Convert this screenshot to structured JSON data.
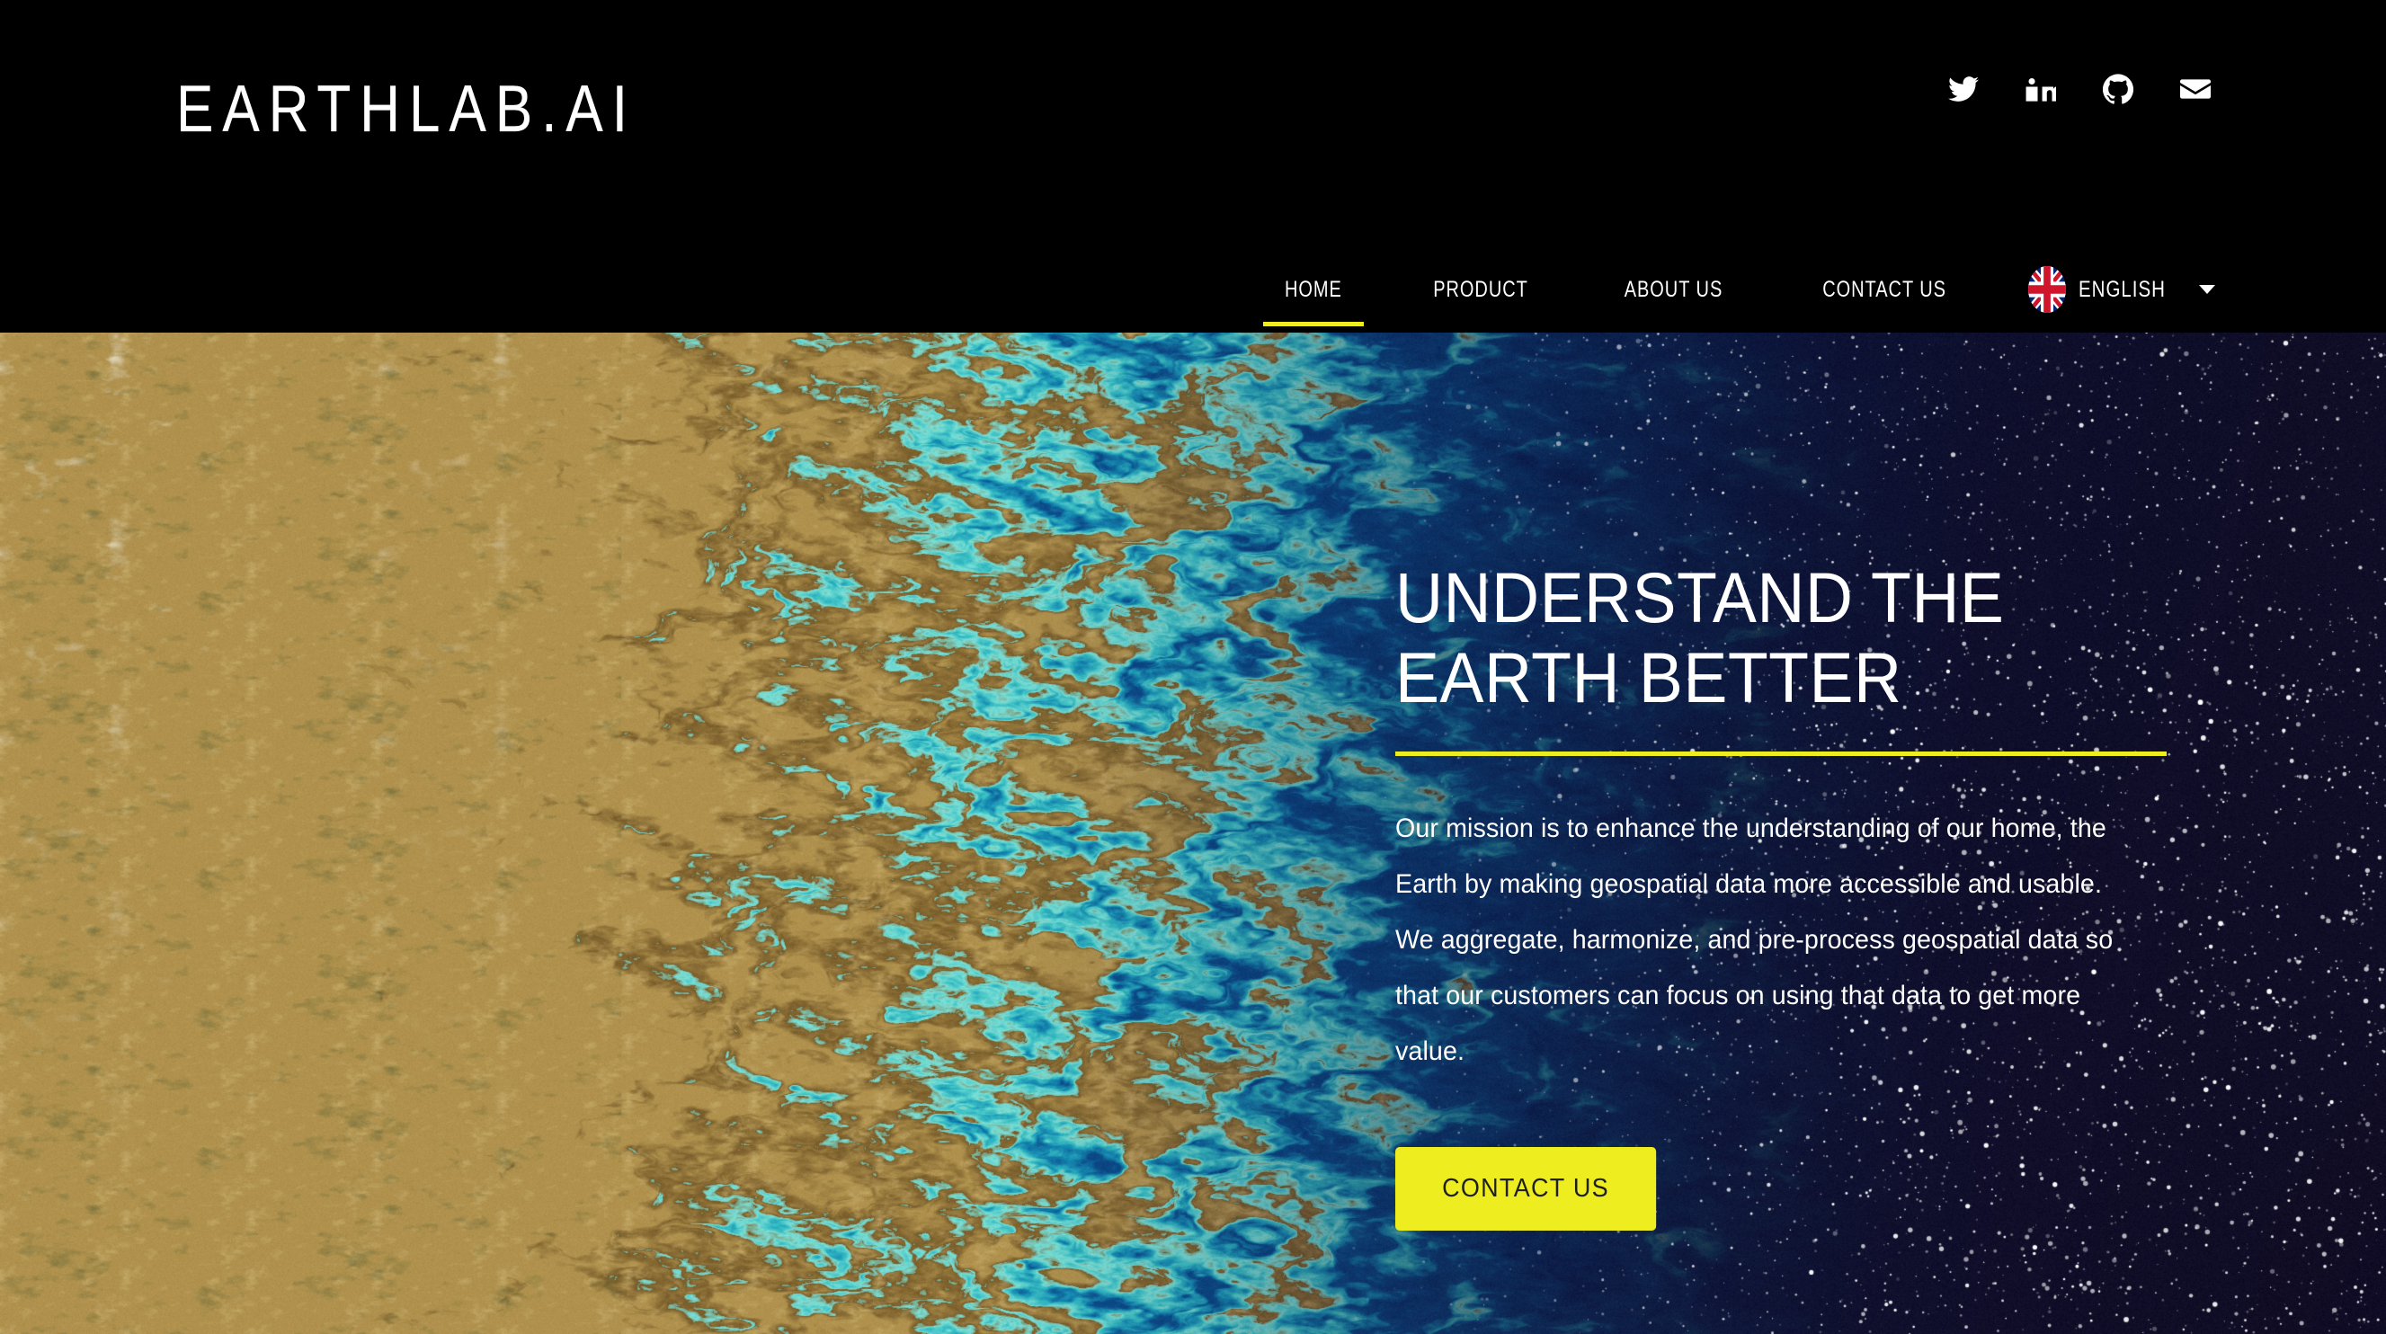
{
  "brand": {
    "logo_text": "EARTHLAB.AI"
  },
  "social": [
    {
      "name": "twitter",
      "label": "Twitter"
    },
    {
      "name": "linkedin",
      "label": "LinkedIn"
    },
    {
      "name": "github",
      "label": "GitHub"
    },
    {
      "name": "email",
      "label": "Email"
    }
  ],
  "nav": {
    "items": [
      {
        "label": "HOME",
        "active": true
      },
      {
        "label": "PRODUCT",
        "active": false
      },
      {
        "label": "ABOUT US",
        "active": false
      },
      {
        "label": "CONTACT US",
        "active": false
      }
    ],
    "language": {
      "label": "ENGLISH",
      "flag": "uk-flag-icon",
      "caret": "chevron-down-icon"
    }
  },
  "hero": {
    "title": "UNDERSTAND THE EARTH BETTER",
    "body": "Our mission is to enhance the understanding of our home, the Earth by making geospatial data more accessible and usable. We aggregate, harmonize, and pre-process geospatial data so that our customers can focus on using that data to get more value.",
    "cta_label": "CONTACT US",
    "background": "satellite-coastal-imagery-to-starfield"
  },
  "colors": {
    "accent_yellow": "#eded1f",
    "header_black": "#000000",
    "text_white": "#ffffff",
    "cta_text": "#1f1f1f"
  }
}
